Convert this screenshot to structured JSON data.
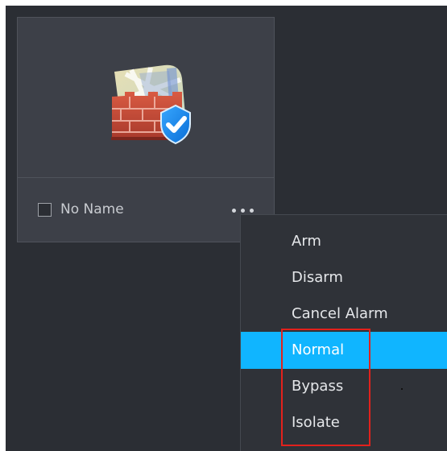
{
  "zone_card": {
    "name": "No Name",
    "checked": false,
    "icon": "firewall-map-shield-icon",
    "more_icon": "more-dots-icon"
  },
  "context_menu": {
    "items": [
      {
        "label": "Arm",
        "selected": false
      },
      {
        "label": "Disarm",
        "selected": false
      },
      {
        "label": "Cancel Alarm",
        "selected": false
      },
      {
        "label": "Normal",
        "selected": true
      },
      {
        "label": "Bypass",
        "selected": false
      },
      {
        "label": "Isolate",
        "selected": false
      }
    ]
  },
  "colors": {
    "background": "#2b2e34",
    "card": "#3d4048",
    "menu": "#2f3238",
    "selected": "#10b5ff",
    "annotation": "#e2211c"
  }
}
